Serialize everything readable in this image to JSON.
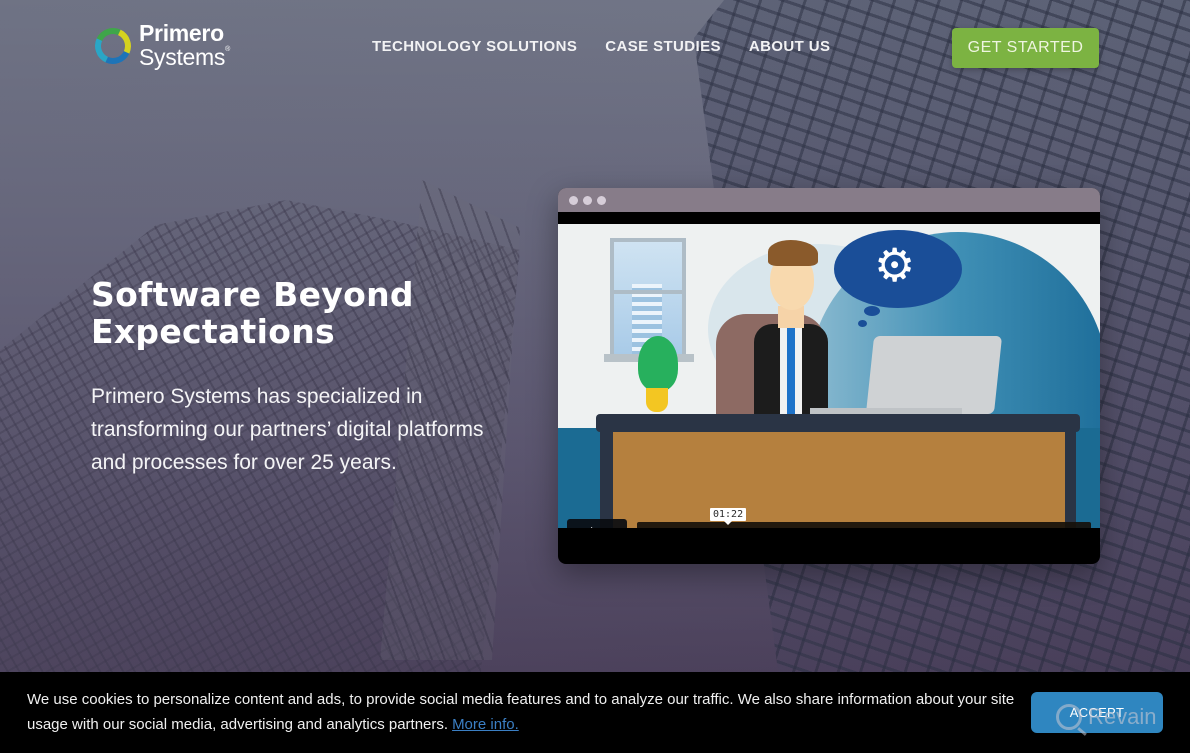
{
  "brand": {
    "name_line1": "Primero",
    "name_line2": "Systems",
    "registered_mark": "®"
  },
  "nav": {
    "items": [
      {
        "label": "TECHNOLOGY SOLUTIONS"
      },
      {
        "label": "CASE STUDIES"
      },
      {
        "label": "ABOUT US"
      }
    ],
    "cta_label": "GET STARTED"
  },
  "hero": {
    "title": "Software Beyond Expectations",
    "description": "Primero Systems has specialized in transforming our partners’ digital platforms and processes for over 25 years."
  },
  "video": {
    "time_tooltip": "01:22",
    "progress_percent": 0,
    "icons": {
      "play": "play-icon",
      "volume": "volume-bars-icon",
      "settings": "gear-icon",
      "fullscreen": "fullscreen-icon"
    },
    "gear_glyph": "⚙",
    "settings_glyph": "⚙",
    "fullscreen_glyph": "⛶"
  },
  "cookie_banner": {
    "text": "We use cookies to personalize content and ads, to provide social media features and to analyze our traffic. We also share information about your site usage with our social media, advertising and analytics partners.",
    "link_label": "More info.",
    "accept_label": "ACCEPT"
  },
  "watermark": {
    "label": "Revain"
  },
  "colors": {
    "cta": "#7cb342",
    "accept": "#2f86c0",
    "link": "#3b7fc4",
    "video_titlebar": "#877c89"
  }
}
